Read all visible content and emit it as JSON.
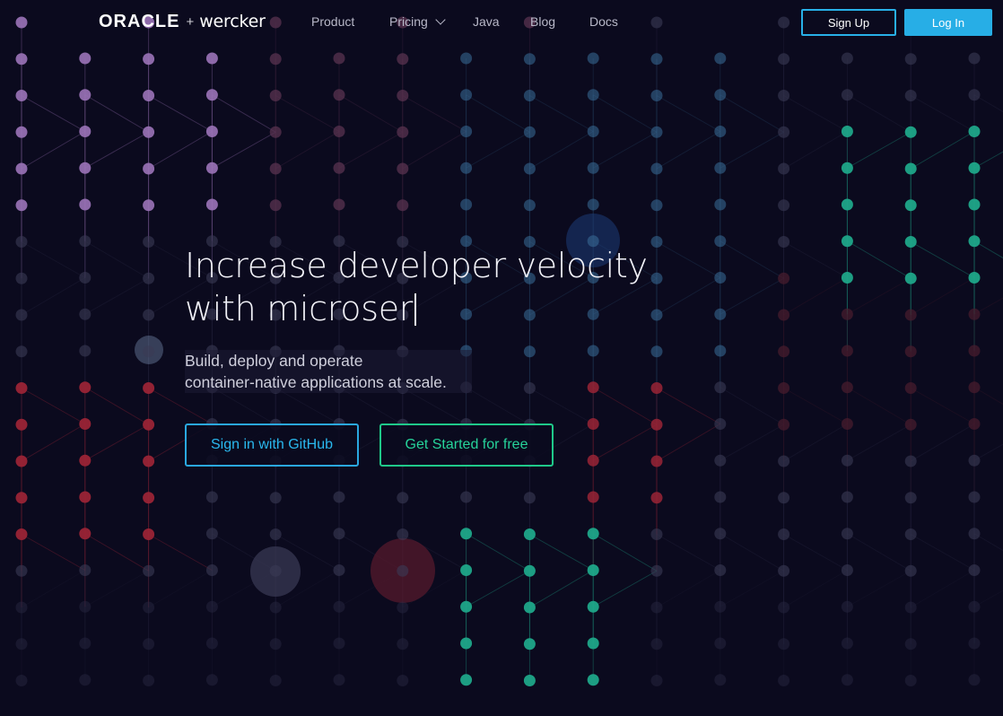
{
  "nav": {
    "logo_oracle": "ORACLE",
    "logo_plus": "+",
    "logo_wercker": "wercker",
    "items": [
      {
        "label": "Product"
      },
      {
        "label": "Pricing"
      },
      {
        "label": "Java"
      },
      {
        "label": "Blog"
      },
      {
        "label": "Docs"
      }
    ],
    "signup_label": "Sign Up",
    "login_label": "Log In"
  },
  "hero": {
    "title_line1": "Increase developer velocity",
    "title_line2": "with microser",
    "subtitle_line1": "Build, deploy and operate",
    "subtitle_line2": "container-native applications at scale.",
    "github_button": "Sign in with GitHub",
    "started_button": "Get Started for free"
  },
  "colors": {
    "background": "#0b0a1e",
    "accent_blue": "#27aee6",
    "accent_green": "#1fc98a",
    "dot_purple": "#9b73b8",
    "dot_red": "#9a2436",
    "dot_teal": "#1fa789",
    "dot_blue": "#3a6f9a"
  }
}
